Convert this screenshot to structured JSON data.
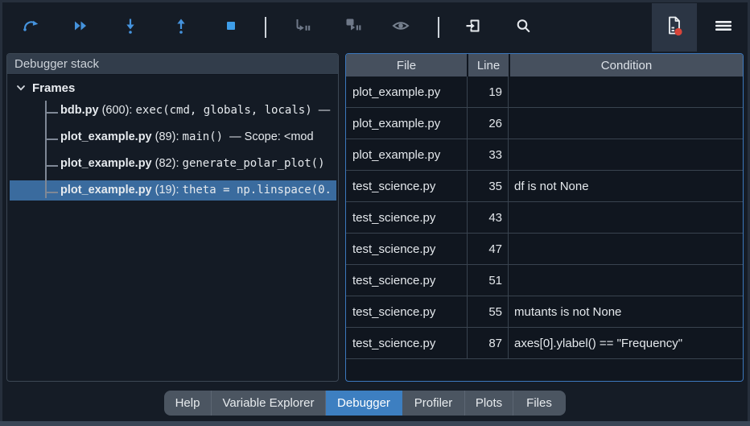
{
  "toolbar": {
    "buttons": [
      {
        "id": "run-current-line",
        "icon": "curved-arrow-icon",
        "state": "enabled"
      },
      {
        "id": "continue-execution",
        "icon": "fast-forward-icon",
        "state": "enabled"
      },
      {
        "id": "step-into",
        "icon": "arrow-down-dot-icon",
        "state": "enabled"
      },
      {
        "id": "step-return",
        "icon": "arrow-up-dot-icon",
        "state": "enabled"
      },
      {
        "id": "stop-debugging",
        "icon": "stop-square-icon",
        "state": "enabled"
      },
      {
        "id": "continue-to-breakpoint",
        "icon": "play-pause-line-icon",
        "state": "disabled"
      },
      {
        "id": "continue-over-breakpoint",
        "icon": "play-pause-square-icon",
        "state": "disabled"
      },
      {
        "id": "toggle-visibility",
        "icon": "eye-icon",
        "state": "disabled"
      },
      {
        "id": "enter-debugging",
        "icon": "enter-icon",
        "state": "enabled"
      },
      {
        "id": "search",
        "icon": "search-icon",
        "state": "enabled"
      },
      {
        "id": "breakpoints-panel-toggle",
        "icon": "document-breakpoint-icon",
        "state": "active"
      },
      {
        "id": "options-menu",
        "icon": "hamburger-icon",
        "state": "enabled"
      }
    ]
  },
  "left_panel": {
    "title": "Debugger stack",
    "frames_label": "Frames",
    "frames": [
      {
        "file": "bdb.py",
        "lineinfo": "(600):",
        "code": "exec(cmd, globals, locals)",
        "suffix": "—"
      },
      {
        "file": "plot_example.py",
        "lineinfo": "(89):",
        "code": "main()",
        "suffix": "—  Scope: <mod"
      },
      {
        "file": "plot_example.py",
        "lineinfo": "(82):",
        "code": "generate_polar_plot()",
        "suffix": ""
      },
      {
        "file": "plot_example.py",
        "lineinfo": "(19):",
        "code": "theta = np.linspace(0.",
        "suffix": ""
      }
    ],
    "selected_frame_index": 3
  },
  "breakpoints": {
    "columns": {
      "file": "File",
      "line": "Line",
      "condition": "Condition"
    },
    "rows": [
      {
        "file": "plot_example.py",
        "line": "19",
        "condition": ""
      },
      {
        "file": "plot_example.py",
        "line": "26",
        "condition": ""
      },
      {
        "file": "plot_example.py",
        "line": "33",
        "condition": ""
      },
      {
        "file": "test_science.py",
        "line": "35",
        "condition": "df is not None"
      },
      {
        "file": "test_science.py",
        "line": "43",
        "condition": ""
      },
      {
        "file": "test_science.py",
        "line": "47",
        "condition": ""
      },
      {
        "file": "test_science.py",
        "line": "51",
        "condition": ""
      },
      {
        "file": "test_science.py",
        "line": "55",
        "condition": "mutants is not None"
      },
      {
        "file": "test_science.py",
        "line": "87",
        "condition": "axes[0].ylabel() == \"Frequency\""
      }
    ]
  },
  "bottom_tabs": {
    "tabs": [
      {
        "label": "Help"
      },
      {
        "label": "Variable Explorer"
      },
      {
        "label": "Debugger"
      },
      {
        "label": "Profiler"
      },
      {
        "label": "Plots"
      },
      {
        "label": "Files"
      }
    ],
    "active": "Debugger"
  },
  "colors": {
    "accent_blue": "#4593dd",
    "selection_blue": "#3a6b9e",
    "active_tab_blue": "#3d7fc1",
    "focus_border_blue": "#3c78bd",
    "breakpoint_red": "#d9453a",
    "window_bg": "#151c26",
    "table_bg": "#10161f",
    "header_gray": "#46505e",
    "tabbar_gray": "#4b5561"
  }
}
